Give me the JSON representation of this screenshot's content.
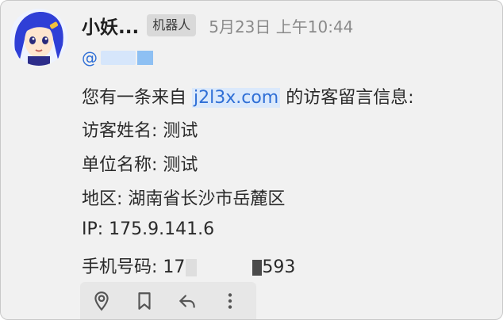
{
  "message": {
    "sender_name": "小妖...",
    "bot_badge": "机器人",
    "timestamp": "5月23日 上午10:44",
    "mention_prefix": "@",
    "intro_before": "您有一条来自 ",
    "intro_link": "j2l3x.com",
    "intro_after": " 的访客留言信息:",
    "visitor_name": "访客姓名: 测试",
    "company": "单位名称: 测试",
    "region": "地区: 湖南省长沙市岳麓区",
    "ip": "IP: 175.9.141.6",
    "phone_prefix": "手机号码: 17",
    "phone_suffix": "593"
  },
  "actions": [
    "pin-icon",
    "bookmark-icon",
    "reply-icon",
    "more-vertical-icon"
  ]
}
